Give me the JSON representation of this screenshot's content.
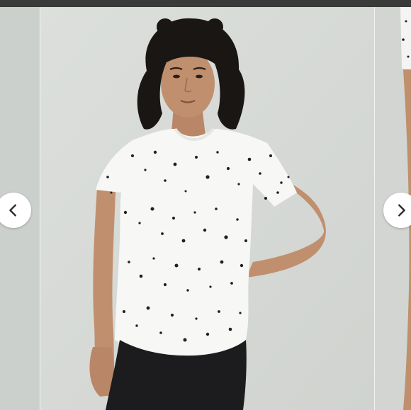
{
  "gallery": {
    "slides": [
      {
        "image": "product-photo-previous",
        "state": "partial"
      },
      {
        "image": "product-photo-model-white-speckled-tee",
        "state": "active"
      },
      {
        "image": "product-photo-next",
        "state": "partial"
      }
    ],
    "prev_icon": "chevron-left-icon",
    "next_icon": "chevron-right-icon"
  },
  "colors": {
    "topbar": "#3a3a3a",
    "backdrop": "#d8dbd8",
    "shirt": "#f7f7f5",
    "speckle": "#1f1f24",
    "pants": "#1c1c1e",
    "hair": "#1a1614",
    "skin": "#c08f6e"
  }
}
